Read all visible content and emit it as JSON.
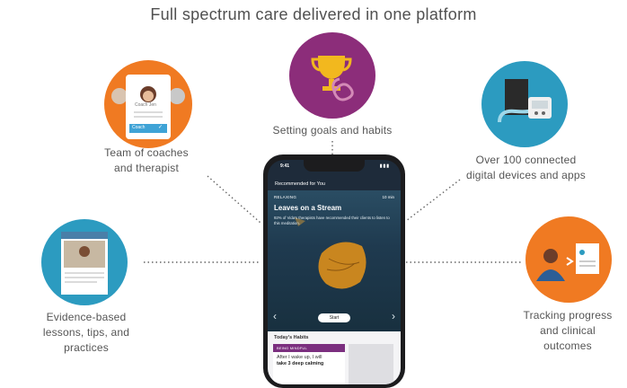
{
  "page": {
    "title": "Full spectrum care delivered in one platform"
  },
  "features": {
    "coaches": {
      "label_line1": "Team of coaches",
      "label_line2": "and therapist",
      "color": "#f07a22",
      "card_name": "Coach Jen",
      "card_button": "Coach",
      "card_check": "✓"
    },
    "goals": {
      "label": "Setting goals and habits",
      "color": "#8c2d7a"
    },
    "devices": {
      "label_line1": "Over 100 connected",
      "label_line2": "digital devices and apps",
      "color": "#2c9bc0"
    },
    "evidence": {
      "label_line1": "Evidence-based",
      "label_line2": "lessons, tips, and",
      "label_line3": "practices",
      "color": "#2c9bc0"
    },
    "tracking": {
      "label_line1": "Tracking progress",
      "label_line2": "and clinical",
      "label_line3": "outcomes",
      "color": "#f07a22"
    }
  },
  "phone": {
    "time": "9:41",
    "recommended": "Recommended for You",
    "category": "RELAXING",
    "duration": "10 min",
    "title": "Leaves on a Stream",
    "description": "92% of Vida's therapists have recommended their clients to listen to this meditation.",
    "start": "Start",
    "prev_icon": "‹",
    "next_icon": "›",
    "habits_title": "Today's Habits",
    "habit_category": "BEING MINDFUL",
    "habit_line1": "After I wake up, I will",
    "habit_line2": "take 3 deep calming"
  }
}
